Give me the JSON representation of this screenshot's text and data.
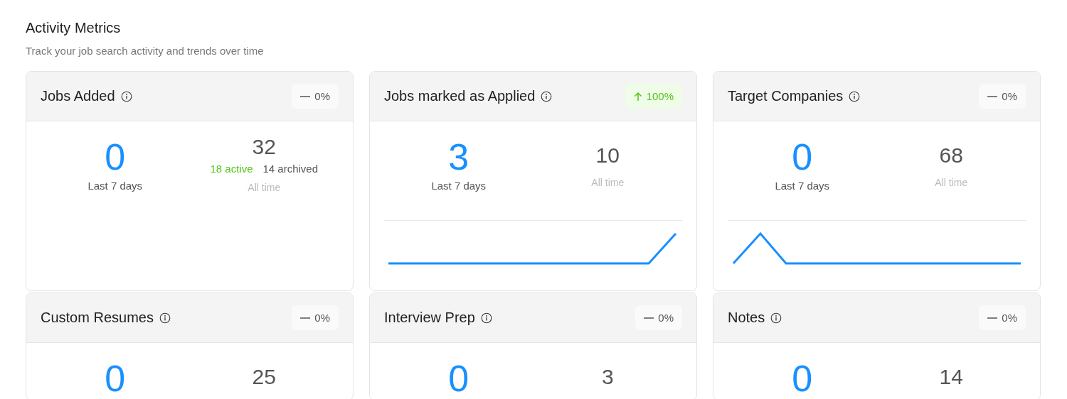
{
  "header": {
    "title": "Activity Metrics",
    "subtitle": "Track your job search activity and trends over time"
  },
  "cards": [
    {
      "title": "Jobs Added",
      "trend": {
        "kind": "flat",
        "text": "0%"
      },
      "recent": {
        "value": "0",
        "label": "Last 7 days"
      },
      "total": {
        "value": "32",
        "active": "18 active",
        "archived": "14 archived",
        "label": "All time"
      }
    },
    {
      "title": "Jobs marked as Applied",
      "trend": {
        "kind": "up",
        "text": "100%"
      },
      "recent": {
        "value": "3",
        "label": "Last 7 days"
      },
      "total": {
        "value": "10",
        "label": "All time"
      },
      "sparkline": {
        "kind": "rise_at_end"
      }
    },
    {
      "title": "Target Companies",
      "trend": {
        "kind": "flat",
        "text": "0%"
      },
      "recent": {
        "value": "0",
        "label": "Last 7 days"
      },
      "total": {
        "value": "68",
        "label": "All time"
      },
      "sparkline": {
        "kind": "peak_at_start"
      }
    },
    {
      "title": "Custom Resumes",
      "trend": {
        "kind": "flat",
        "text": "0%"
      },
      "recent": {
        "value": "0"
      },
      "total": {
        "value": "25"
      }
    },
    {
      "title": "Interview Prep",
      "trend": {
        "kind": "flat",
        "text": "0%"
      },
      "recent": {
        "value": "0"
      },
      "total": {
        "value": "3"
      }
    },
    {
      "title": "Notes",
      "trend": {
        "kind": "flat",
        "text": "0%"
      },
      "recent": {
        "value": "0"
      },
      "total": {
        "value": "14"
      }
    }
  ]
}
